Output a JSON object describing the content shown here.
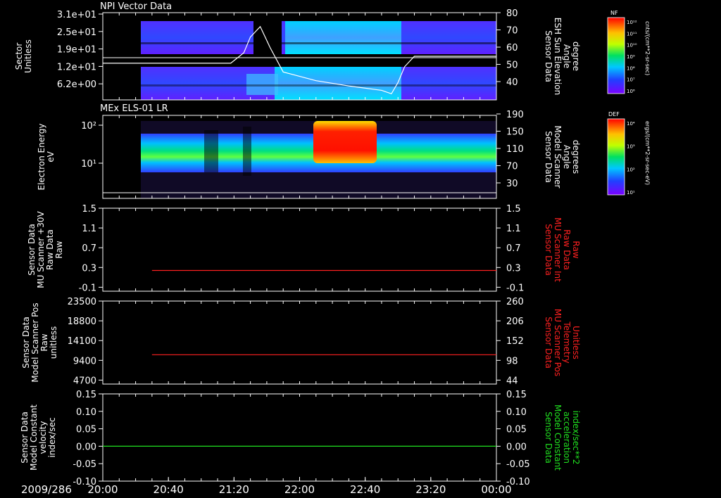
{
  "date_label": "2009/286",
  "x_ticks": [
    "20:00",
    "20:40",
    "21:20",
    "22:00",
    "22:40",
    "23:20",
    "00:00"
  ],
  "panel_titles": {
    "npi": "NPI Vector Data",
    "els": "MEx ELS-01 LR"
  },
  "colorbars": {
    "nf": {
      "label": "NF",
      "ticks": [
        "10¹²",
        "10¹¹",
        "10¹⁰",
        "10⁹",
        "10⁸",
        "10⁷",
        "10⁶"
      ],
      "unit": "cnts/(cm**2-sr-sec)"
    },
    "def": {
      "label": "DEF",
      "ticks": [
        "10⁴",
        "10³",
        "10²",
        "10¹"
      ],
      "unit": "ergs/(cm**2-sr-sec-eV)"
    }
  },
  "colors": {
    "background": "#000000",
    "axis": "#ffffff",
    "red_trace": "#ff2020",
    "green_trace": "#20e020"
  },
  "chart_data": [
    {
      "type": "heatmap",
      "title": "NPI Vector Data",
      "left_axis": {
        "lines": [
          "Sector",
          "Unitless"
        ],
        "ticks": [
          "3.1e+01",
          "2.5e+01",
          "1.9e+01",
          "1.2e+01",
          "6.2e+00"
        ]
      },
      "right_axis": {
        "lines": [
          "Sensor Data",
          "ESH Sun Elevation",
          "Angle",
          "degree"
        ],
        "ticks": [
          "80",
          "70",
          "60",
          "50",
          "40"
        ],
        "ylim": [
          30,
          80
        ]
      },
      "overlay_series": {
        "name": "ESH Sun Elevation Angle",
        "x": [
          "20:00",
          "21:18",
          "21:26",
          "21:30",
          "21:36",
          "21:42",
          "21:50",
          "22:10",
          "22:30",
          "22:50",
          "22:56",
          "23:00",
          "23:04",
          "23:10",
          "00:00"
        ],
        "y": [
          51,
          51,
          57,
          66,
          72,
          60,
          46,
          41,
          38,
          35.5,
          33.5,
          40,
          49,
          55,
          55
        ]
      }
    },
    {
      "type": "heatmap",
      "title": "MEx ELS-01 LR",
      "left_axis": {
        "lines": [
          "Electron Energy",
          "eV"
        ],
        "ticks": [
          "10²",
          "10¹"
        ]
      },
      "right_axis": {
        "lines": [
          "Sensor Data",
          "Model Scanner",
          "Angle",
          "degrees"
        ],
        "ticks": [
          "190",
          "150",
          "110",
          "70",
          "30"
        ],
        "ylim": [
          0,
          190
        ]
      },
      "overlay_series": {
        "name": "Model Scanner Angle",
        "x": [
          "20:00",
          "00:00"
        ],
        "y": [
          9,
          9
        ]
      }
    },
    {
      "type": "line",
      "left_axis": {
        "lines": [
          "Sensor Data",
          "MU Scanner +30V",
          "Raw Data",
          "Raw"
        ],
        "ticks": [
          "1.5",
          "1.1",
          "0.7",
          "0.3",
          "-0.1"
        ],
        "ylim": [
          -0.5,
          1.5
        ]
      },
      "right_axis": {
        "lines": [
          "Sensor Data",
          "MU Scanner Int",
          "Raw Data",
          "Raw"
        ],
        "ticks": [
          "1.5",
          "1.1",
          "0.7",
          "0.3",
          "-0.1"
        ],
        "ylim": [
          -0.5,
          1.5
        ]
      },
      "series": [
        {
          "x": [
            "20:30",
            "00:00"
          ],
          "y": [
            0,
            0
          ]
        }
      ]
    },
    {
      "type": "line",
      "left_axis": {
        "lines": [
          "Sensor Data",
          "Model Scanner Pos",
          "Raw",
          "unitless"
        ],
        "ticks": [
          "23500",
          "18800",
          "14100",
          "9400",
          "4700"
        ],
        "ylim": [
          0,
          23500
        ]
      },
      "right_axis": {
        "lines": [
          "Sensor Data",
          "MU Scanner Pos",
          "Telemetry",
          "Unitless"
        ],
        "ticks": [
          "260",
          "206",
          "152",
          "98",
          "44"
        ],
        "ylim": [
          -10,
          260
        ]
      },
      "series": [
        {
          "x": [
            "20:30",
            "00:00"
          ],
          "y": [
            8300,
            8300
          ]
        }
      ]
    },
    {
      "type": "line",
      "left_axis": {
        "lines": [
          "Sensor Data",
          "Model Constant",
          "velocity",
          "index/sec"
        ],
        "ticks": [
          "0.15",
          "0.10",
          "0.05",
          "0.00",
          "-0.05",
          "-0.10"
        ],
        "ylim": [
          -0.1,
          0.15
        ]
      },
      "right_axis": {
        "lines": [
          "Sensor Data",
          "Model Constant",
          "acceleration",
          "index/sec**2"
        ],
        "ticks": [
          "0.15",
          "0.10",
          "0.05",
          "0.00",
          "-0.05",
          "-0.10"
        ],
        "ylim": [
          -0.1,
          0.15
        ]
      },
      "series": [
        {
          "x": [
            "20:00",
            "00:00"
          ],
          "y": [
            0,
            0
          ]
        }
      ]
    }
  ]
}
